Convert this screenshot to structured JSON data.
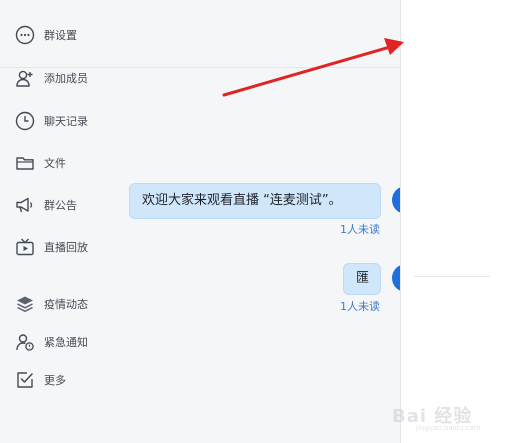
{
  "messages": [
    {
      "text": "欢迎大家来观看直播 “连麦测试”。",
      "status": "1人未读"
    },
    {
      "text": "匯",
      "status": "1人未读"
    }
  ],
  "side_menu": {
    "group_settings": {
      "label": "群设置",
      "icon": "more-circle-icon"
    },
    "add_member": {
      "label": "添加成员",
      "icon": "add-user-icon"
    },
    "chat_history": {
      "label": "聊天记录",
      "icon": "clock-icon"
    },
    "files": {
      "label": "文件",
      "icon": "folder-icon"
    },
    "announcement": {
      "label": "群公告",
      "icon": "megaphone-icon"
    },
    "live_replay": {
      "label": "直播回放",
      "icon": "tv-icon"
    },
    "epidemic": {
      "label": "疫情动态",
      "icon": "layers-icon"
    },
    "urgent_notice": {
      "label": "紧急通知",
      "icon": "user-alert-icon"
    },
    "more": {
      "label": "更多",
      "icon": "checkbox-icon"
    }
  },
  "watermark": {
    "text": "Bai 经验",
    "sub": "jingyan.baidu.com"
  },
  "colors": {
    "bubble": "#cfe6fb",
    "status_link": "#3a7bd5",
    "annotation_arrow": "#e02424",
    "avatar": "#1e6fd9"
  }
}
